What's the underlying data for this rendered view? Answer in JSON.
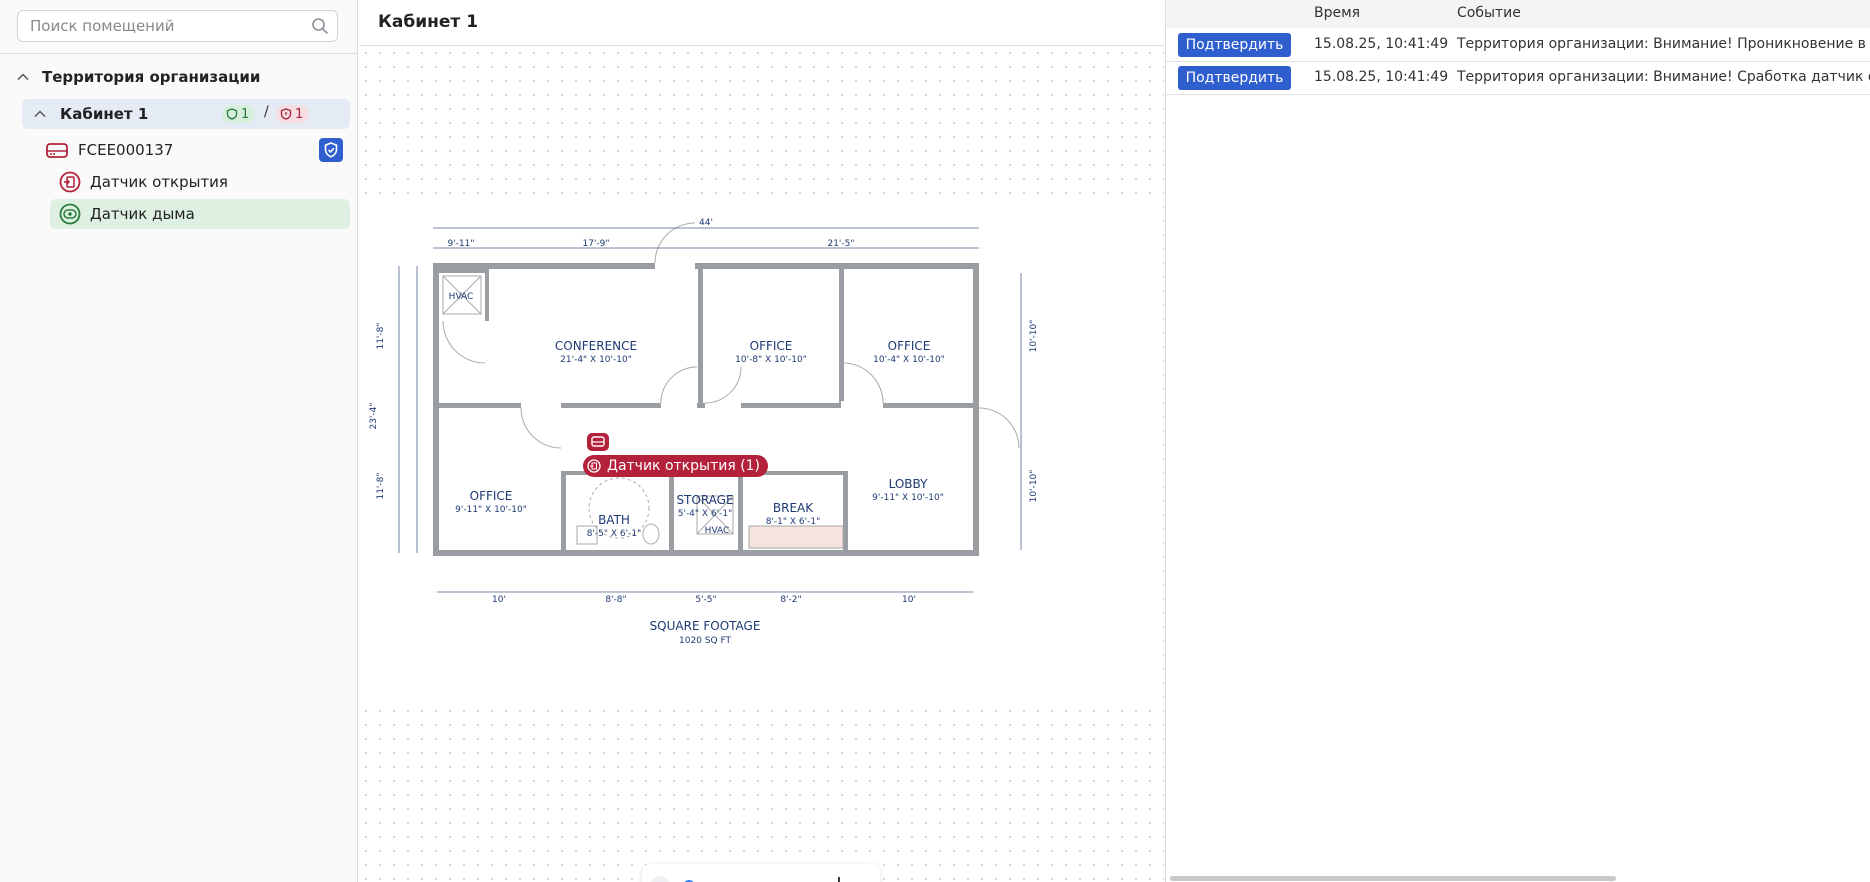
{
  "sidebar": {
    "search_placeholder": "Поиск помещений",
    "tree": {
      "org_label": "Территория организации",
      "room": {
        "label": "Кабинет 1",
        "armed_count": "1",
        "separator": "/",
        "alarm_count": "1"
      },
      "device": {
        "label": "FCEE000137"
      },
      "sensors": [
        {
          "label": "Датчик открытия",
          "status_color": "#b3213a"
        },
        {
          "label": "Датчик дыма",
          "status_color": "#2a7a3d"
        }
      ]
    }
  },
  "center": {
    "title": "Кабинет 1",
    "plan_marker_label": "Датчик открытия (1)",
    "plan": {
      "rooms": [
        {
          "name": "CONFERENCE",
          "size": "21'-4\" X 10'-10\""
        },
        {
          "name": "OFFICE",
          "size": "10'-8\" X 10'-10\""
        },
        {
          "name": "OFFICE",
          "size": "10'-4\" X 10'-10\""
        },
        {
          "name": "OFFICE",
          "size": "9'-11\" X 10'-10\""
        },
        {
          "name": "BATH",
          "size": "8'-5\" X 6'-1\""
        },
        {
          "name": "STORAGE",
          "size": "5'-4\" X 6'-1\""
        },
        {
          "name": "BREAK",
          "size": "8'-1\" X 6'-1\""
        },
        {
          "name": "LOBBY",
          "size": "9'-11\" X 10'-10\""
        },
        {
          "name": "HVAC",
          "size": ""
        },
        {
          "name": "HVAC",
          "size": ""
        }
      ],
      "dims_top": [
        "44'",
        "9'-11\"",
        "17'-9\"",
        "21'-5\""
      ],
      "dims_bottom": [
        "10'",
        "8'-8\"",
        "5'-5\"",
        "8'-2\"",
        "10'"
      ],
      "dims_left": [
        "11'-8\"",
        "23'-4\"",
        "11'-8\""
      ],
      "dims_right": [
        "10'-10\"",
        "10'-10\""
      ],
      "footage_title": "SQUARE FOOTAGE",
      "footage_value": "1020 SQ FT"
    },
    "zoom": {
      "minus": "−",
      "plus": "+",
      "level": 0
    }
  },
  "events": {
    "columns": {
      "action": "",
      "time": "Время",
      "event": "Событие"
    },
    "rows": [
      {
        "action": "Подтвердить",
        "time": "15.08.25, 10:41:49",
        "event": "Территория организации: Внимание! Проникновение в помещение"
      },
      {
        "action": "Подтвердить",
        "time": "15.08.25, 10:41:49",
        "event": "Территория организации: Внимание! Сработка датчик открытия"
      }
    ]
  },
  "colors": {
    "accent": "#2f5fcf",
    "alarm": "#b3213a",
    "ok": "#2a7a3d",
    "plan_ink": "#1f3a73"
  }
}
